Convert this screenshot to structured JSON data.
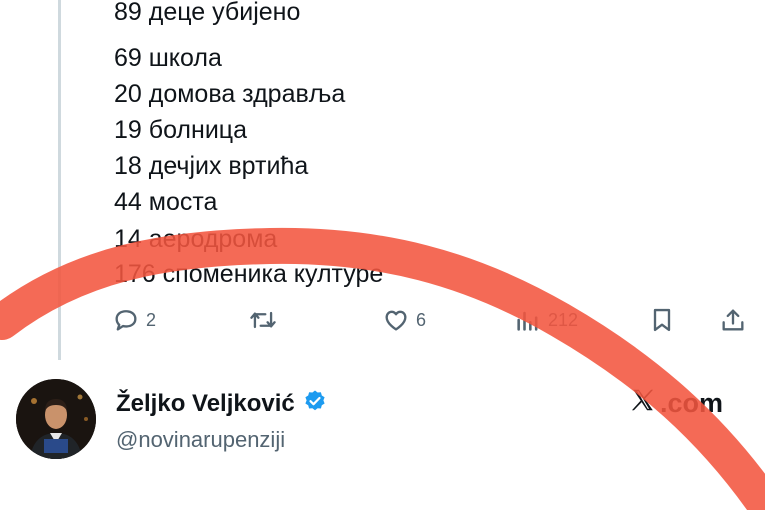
{
  "tweet": {
    "lines": [
      "89 деце убијено",
      "69 школа",
      "20 домова здравља",
      "19 болница",
      "18 дечјих вртића",
      "44 моста",
      "14 аеродрома",
      "176 споменика културе"
    ]
  },
  "actions": {
    "reply_count": "2",
    "like_count": "6",
    "view_count": "212"
  },
  "author": {
    "name": "Željko Veljković",
    "handle": "@novinarupenziji",
    "verified": true
  },
  "brand": {
    "label": ".com"
  },
  "colors": {
    "text": "#0f1419",
    "muted": "#536471",
    "verified": "#1d9bf0",
    "annotation": "#f2553f"
  },
  "icons": [
    "reply-icon",
    "retweet-icon",
    "like-icon",
    "views-icon",
    "bookmark-icon",
    "share-icon",
    "verified-badge-icon",
    "x-logo-icon"
  ]
}
